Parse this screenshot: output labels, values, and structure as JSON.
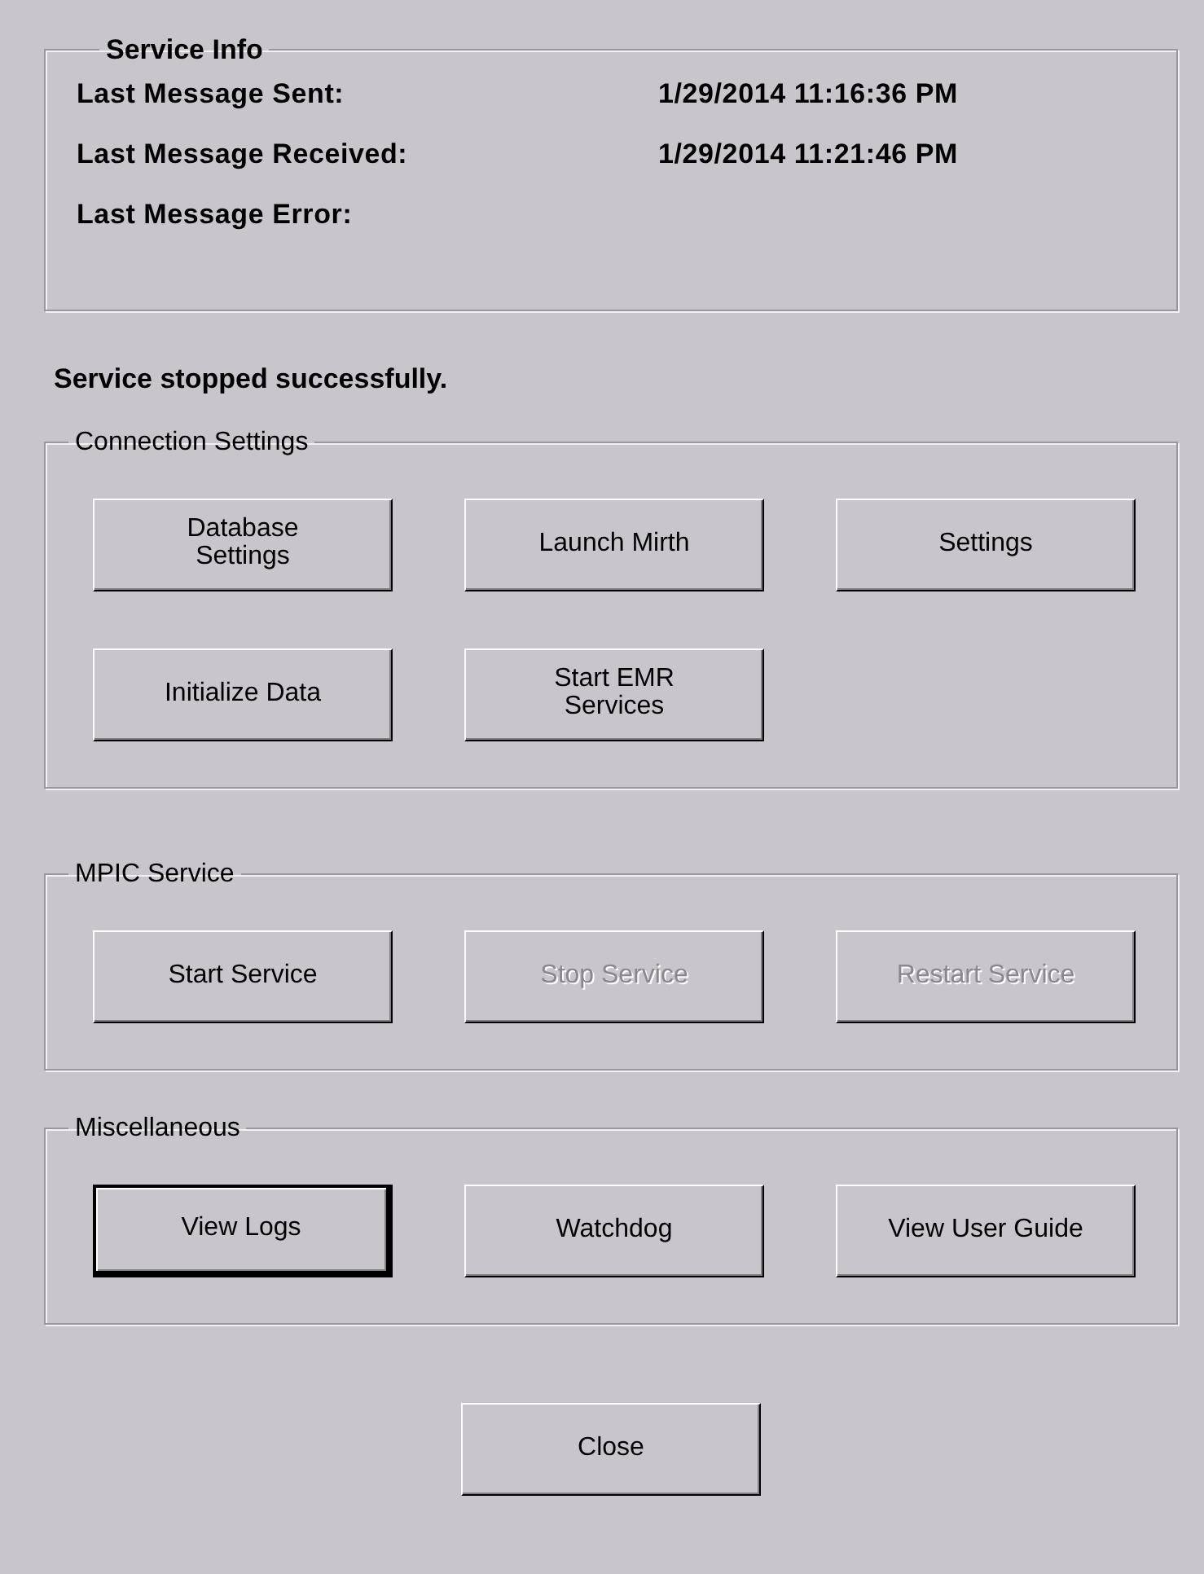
{
  "service_info": {
    "title": "Service Info",
    "rows": [
      {
        "label": "Last Message Sent:",
        "value": "1/29/2014 11:16:36 PM"
      },
      {
        "label": "Last Message Received:",
        "value": "1/29/2014 11:21:46 PM"
      },
      {
        "label": "Last Message Error:"
      }
    ]
  },
  "status_message": "Service stopped successfully.",
  "groups": [
    {
      "title": "Connection Settings",
      "buttons": [
        {
          "label": "Database\nSettings",
          "disabled": false,
          "focused": false
        },
        {
          "label": "Launch Mirth",
          "disabled": false,
          "focused": false
        },
        {
          "label": "Settings",
          "disabled": false,
          "focused": false
        },
        {
          "label": "Initialize Data",
          "disabled": false,
          "focused": false
        },
        {
          "label": "Start EMR\nServices",
          "disabled": false,
          "focused": false
        }
      ]
    },
    {
      "title": "MPIC Service",
      "buttons": [
        {
          "label": "Start Service",
          "disabled": false,
          "focused": false
        },
        {
          "label": "Stop Service",
          "disabled": true,
          "focused": false
        },
        {
          "label": "Restart Service",
          "disabled": true,
          "focused": false
        }
      ]
    },
    {
      "title": "Miscellaneous",
      "buttons": [
        {
          "label": "View Logs",
          "disabled": false,
          "focused": true
        },
        {
          "label": "Watchdog",
          "disabled": false,
          "focused": false
        },
        {
          "label": "View User Guide",
          "disabled": false,
          "focused": false
        }
      ]
    }
  ],
  "close_button": {
    "label": "Close",
    "disabled": false,
    "focused": false
  }
}
